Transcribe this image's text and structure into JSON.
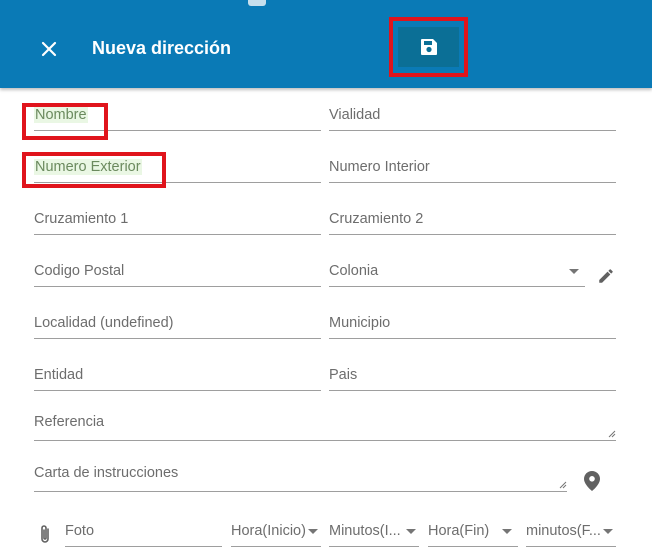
{
  "header": {
    "title": "Nueva dirección",
    "close_icon": "close-icon",
    "save_icon": "floppy-disk-icon",
    "bg_color": "#0a7ab6"
  },
  "form": {
    "nombre": "Nombre",
    "vialidad": "Vialidad",
    "numero_exterior": "Numero Exterior",
    "numero_interior": "Numero Interior",
    "cruzamiento_1": "Cruzamiento 1",
    "cruzamiento_2": "Cruzamiento 2",
    "codigo_postal": "Codigo Postal",
    "colonia": "Colonia",
    "localidad": "Localidad (undefined)",
    "municipio": "Municipio",
    "entidad": "Entidad",
    "pais": "Pais",
    "referencia": "Referencia",
    "carta_instrucciones": "Carta de instrucciones",
    "foto": "Foto",
    "hora_inicio": "Hora(Inicio)",
    "minutos_inicio": "Minutos(I...",
    "hora_fin": "Hora(Fin)",
    "minutos_fin": "minutos(F..."
  },
  "icons": {
    "edit": "pencil-icon",
    "location": "map-pin-icon",
    "attach": "paperclip-icon"
  },
  "highlight_color": "#e0141c"
}
